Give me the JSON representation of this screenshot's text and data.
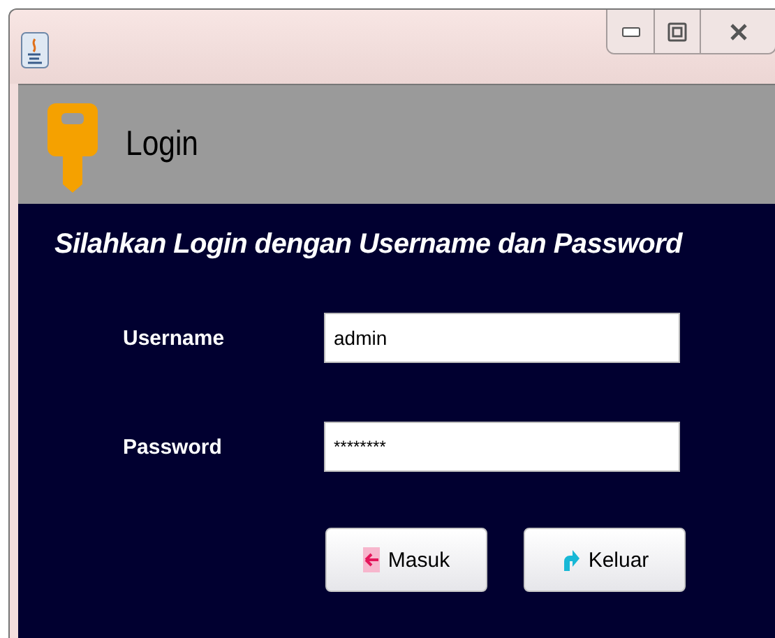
{
  "header": {
    "title": "Login"
  },
  "form": {
    "heading": "Silahkan Login dengan Username dan Password",
    "fields": [
      {
        "label": "Username",
        "value": "admin",
        "kind": "text"
      },
      {
        "label": "Password",
        "value": "********",
        "kind": "password"
      }
    ],
    "buttons": [
      {
        "label": "Masuk",
        "kind": "enter"
      },
      {
        "label": "Keluar",
        "kind": "exit"
      }
    ]
  }
}
